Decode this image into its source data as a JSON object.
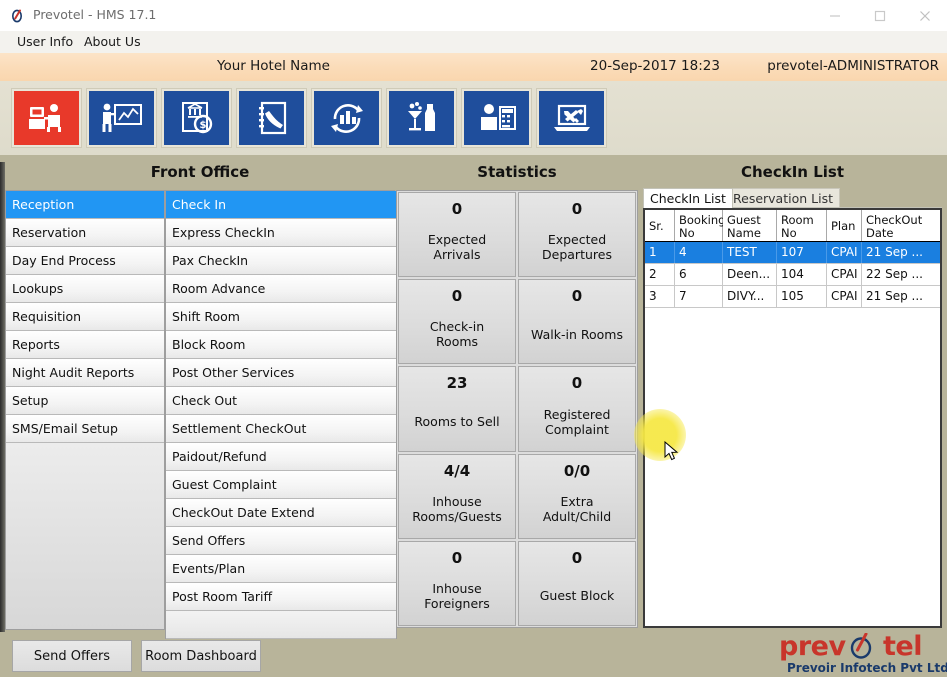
{
  "window": {
    "title": "Prevotel - HMS 17.1",
    "logo_icon": "prevotel-app-icon",
    "minimize_label": "Minimize",
    "maximize_label": "Maximize",
    "close_label": "Close"
  },
  "menu": {
    "items": [
      {
        "label": "User Info"
      },
      {
        "label": "About Us"
      }
    ]
  },
  "banner": {
    "hotel_name": "Your Hotel Name",
    "datetime": "20-Sep-2017 18:23",
    "user": "prevotel-ADMINISTRATOR"
  },
  "toolbar": {
    "buttons": [
      {
        "icon": "reception-desk-icon",
        "color": "#e8392a",
        "active": true
      },
      {
        "icon": "presentation-chart-icon",
        "color": "#1f4e9c",
        "active": false
      },
      {
        "icon": "accounts-invoice-icon",
        "color": "#1f4e9c",
        "active": false
      },
      {
        "icon": "telephone-directory-icon",
        "color": "#1f4e9c",
        "active": false
      },
      {
        "icon": "analytics-cycle-icon",
        "color": "#1f4e9c",
        "active": false
      },
      {
        "icon": "bar-beverage-icon",
        "color": "#1f4e9c",
        "active": false
      },
      {
        "icon": "cashier-counter-icon",
        "color": "#1f4e9c",
        "active": false
      },
      {
        "icon": "utilities-tools-icon",
        "color": "#1f4e9c",
        "active": false
      }
    ]
  },
  "front_office": {
    "title": "Front Office",
    "modules": [
      {
        "label": "Reception",
        "selected": true
      },
      {
        "label": "Reservation",
        "selected": false
      },
      {
        "label": "Day End Process",
        "selected": false
      },
      {
        "label": "Lookups",
        "selected": false
      },
      {
        "label": "Requisition",
        "selected": false
      },
      {
        "label": "Reports",
        "selected": false
      },
      {
        "label": "Night Audit Reports",
        "selected": false
      },
      {
        "label": "Setup",
        "selected": false
      },
      {
        "label": "SMS/Email Setup",
        "selected": false
      }
    ],
    "actions": [
      {
        "label": "Check In",
        "selected": true
      },
      {
        "label": "Express CheckIn",
        "selected": false
      },
      {
        "label": "Pax CheckIn",
        "selected": false
      },
      {
        "label": "Room Advance",
        "selected": false
      },
      {
        "label": "Shift Room",
        "selected": false
      },
      {
        "label": "Block Room",
        "selected": false
      },
      {
        "label": "Post Other Services",
        "selected": false
      },
      {
        "label": "Check Out",
        "selected": false
      },
      {
        "label": "Settlement CheckOut",
        "selected": false
      },
      {
        "label": "Paidout/Refund",
        "selected": false
      },
      {
        "label": "Guest Complaint",
        "selected": false
      },
      {
        "label": "CheckOut Date Extend",
        "selected": false
      },
      {
        "label": "Send Offers",
        "selected": false
      },
      {
        "label": "Events/Plan",
        "selected": false
      },
      {
        "label": "Post Room Tariff",
        "selected": false
      },
      {
        "label": "",
        "selected": false
      }
    ]
  },
  "statistics": {
    "title": "Statistics",
    "cells": [
      {
        "value": "0",
        "label": "Expected\nArrivals"
      },
      {
        "value": "0",
        "label": "Expected\nDepartures"
      },
      {
        "value": "0",
        "label": "Check-in\nRooms"
      },
      {
        "value": "0",
        "label": "Walk-in Rooms"
      },
      {
        "value": "23",
        "label": "Rooms to Sell"
      },
      {
        "value": "0",
        "label": "Registered\nComplaint"
      },
      {
        "value": "4/4",
        "label": "Inhouse\nRooms/Guests"
      },
      {
        "value": "0/0",
        "label": "Extra\nAdult/Child"
      },
      {
        "value": "0",
        "label": "Inhouse\nForeigners"
      },
      {
        "value": "0",
        "label": "Guest Block"
      }
    ]
  },
  "checkin_panel": {
    "title": "CheckIn List",
    "tabs": [
      {
        "label": "CheckIn List",
        "active": true
      },
      {
        "label": "Reservation List",
        "active": false
      }
    ],
    "columns": [
      "Sr.",
      "Booking\nNo",
      "Guest\nName",
      "Room\nNo",
      "Plan",
      "CheckOut\nDate"
    ],
    "rows": [
      {
        "sr": "1",
        "booking_no": "4",
        "guest_name": "TEST",
        "room_no": "107",
        "plan": "CPAI",
        "checkout_date": "21 Sep ...",
        "selected": true
      },
      {
        "sr": "2",
        "booking_no": "6",
        "guest_name": "Deen...",
        "room_no": "104",
        "plan": "CPAI",
        "checkout_date": "22 Sep ...",
        "selected": false
      },
      {
        "sr": "3",
        "booking_no": "7",
        "guest_name": "DIVY...",
        "room_no": "105",
        "plan": "CPAI",
        "checkout_date": "21 Sep ...",
        "selected": false
      }
    ]
  },
  "bottom_bar": {
    "buttons": [
      {
        "label": "Send Offers"
      },
      {
        "label": "Room Dashboard"
      }
    ]
  },
  "brand": {
    "part1": "prev",
    "part2": "tel",
    "tagline": "Prevoir Infotech Pvt Ltd",
    "color": "#c8352b"
  }
}
